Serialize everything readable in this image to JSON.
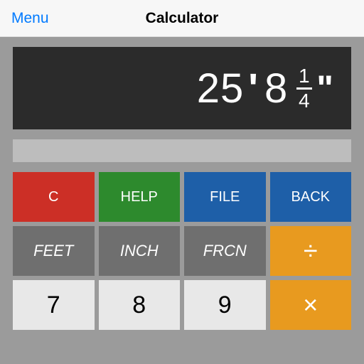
{
  "nav": {
    "menu_label": "Menu",
    "title": "Calculator"
  },
  "display": {
    "feet": "25",
    "feet_mark": "'",
    "inches": "8",
    "frac_num": "1",
    "frac_den": "4",
    "inch_mark": "\""
  },
  "keys": {
    "clear": "C",
    "help": "HELP",
    "file": "FILE",
    "back": "BACK",
    "feet": "FEET",
    "inch": "INCH",
    "frcn": "FRCN",
    "divide": "÷",
    "k7": "7",
    "k8": "8",
    "k9": "9",
    "multiply": "×"
  },
  "colors": {
    "red": "#cc2f26",
    "green": "#2d8a2d",
    "blue": "#1e5fa8",
    "gray": "#6f6f6f",
    "light": "#e8e8e8",
    "orange": "#e89a1f",
    "body_bg": "#9b9b9b",
    "display_bg": "#2b2b2b"
  }
}
